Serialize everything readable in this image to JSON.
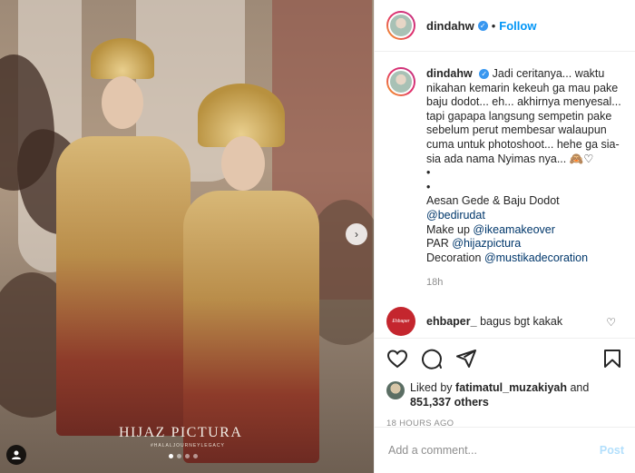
{
  "photo": {
    "watermark": "HIJAZ PICTURA",
    "watermark_sub": "#HALALJOURNEYLEGACY",
    "next_arrow": "›"
  },
  "header": {
    "username": "dindahw",
    "verified_glyph": "✓",
    "separator": "•",
    "follow_label": "Follow"
  },
  "caption": {
    "username": "dindahw",
    "lines": [
      "Jadi ceritanya... waktu nikahan kemarin kekeuh ga mau pake baju dodot... eh... akhirnya menyesal... tapi gapapa langsung sempetin pake sebelum perut membesar walaupun cuma untuk photoshoot... hehe ga sia-sia ada nama Nyimas nya... 🙈♡",
      "•",
      "•",
      "Aesan Gede & Baju Dodot"
    ],
    "credits": [
      {
        "label": "",
        "mention": "@bedirudat"
      },
      {
        "label": "Make up ",
        "mention": "@ikeamakeover"
      },
      {
        "label": "PAR ",
        "mention": "@hijazpictura"
      },
      {
        "label": "Decoration ",
        "mention": "@mustikadecoration"
      }
    ],
    "time": "18h"
  },
  "comment": {
    "avatar_text": "Ehbaper",
    "username": "ehbaper_",
    "text": "bagus bgt kakak",
    "heart": "♡"
  },
  "likes": {
    "prefix": "Liked by ",
    "user": "fatimatul_muzakiyah",
    "and": " and",
    "count": "851,337 others"
  },
  "post_time": "18 HOURS AGO",
  "add_comment": {
    "placeholder": "Add a comment...",
    "post_label": "Post"
  }
}
